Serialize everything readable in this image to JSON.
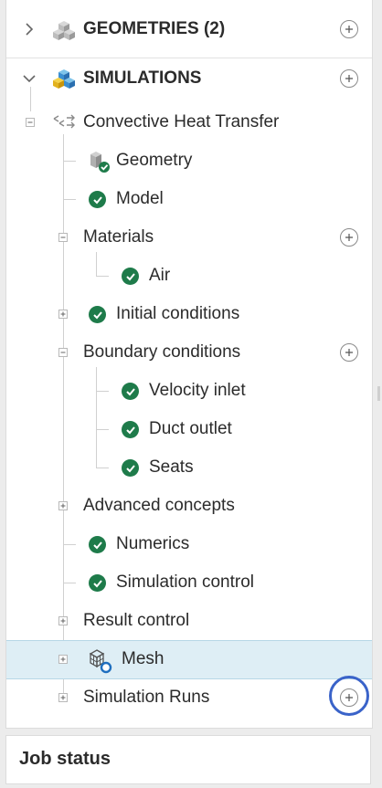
{
  "sections": {
    "geometries": {
      "label": "GEOMETRIES (2)",
      "expanded": false
    },
    "simulations": {
      "label": "SIMULATIONS",
      "expanded": true
    }
  },
  "tree": {
    "root_label": "Convective Heat Transfer",
    "geometry": "Geometry",
    "model": "Model",
    "materials": "Materials",
    "air": "Air",
    "initial_conditions": "Initial conditions",
    "boundary_conditions": "Boundary conditions",
    "velocity_inlet": "Velocity inlet",
    "duct_outlet": "Duct outlet",
    "seats": "Seats",
    "advanced_concepts": "Advanced concepts",
    "numerics": "Numerics",
    "simulation_control": "Simulation control",
    "result_control": "Result control",
    "mesh": "Mesh",
    "simulation_runs": "Simulation Runs"
  },
  "footer": {
    "job_status": "Job status"
  },
  "colors": {
    "check": "#1e7b4a",
    "highlight": "#deeef5",
    "ring": "#3a63c9",
    "mesh_badge": "#1f6fbf"
  }
}
